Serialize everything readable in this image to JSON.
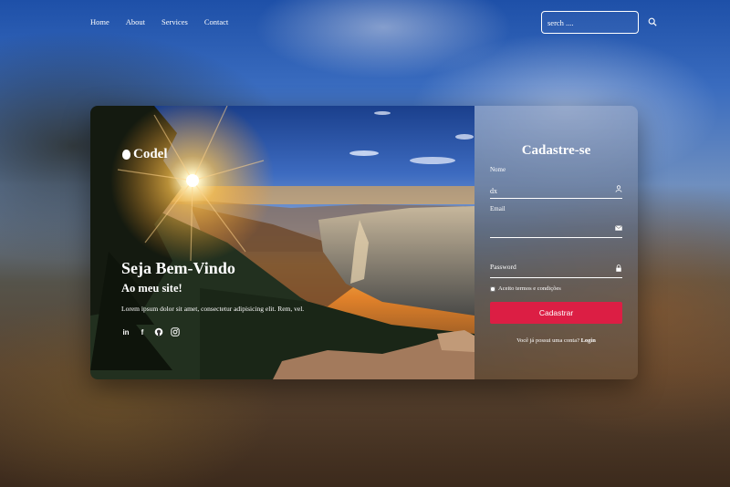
{
  "nav": {
    "items": [
      "Home",
      "About",
      "Services",
      "Contact"
    ]
  },
  "search": {
    "placeholder": "serch ....",
    "icon": "search-icon"
  },
  "hero": {
    "logo": "Codel",
    "title": "Seja Bem-Vindo",
    "subtitle": "Ao meu site!",
    "text": "Lorem ipsum dolor sit amet, consectetur adipisicing elit. Rem, vel.",
    "social": [
      "linkedin-icon",
      "facebook-icon",
      "github-icon",
      "instagram-icon"
    ]
  },
  "form": {
    "title": "Cadastre-se",
    "name_label": "Nome",
    "name_value": "dx",
    "email_label": "Email",
    "email_value": "",
    "password_label": "Password",
    "terms": "Aceito termos e condições",
    "submit": "Cadastrar",
    "login_prompt": "Você já possui uma conta?",
    "login_link": "Login"
  },
  "colors": {
    "accent": "#dc1e44",
    "text": "#ffffff"
  }
}
